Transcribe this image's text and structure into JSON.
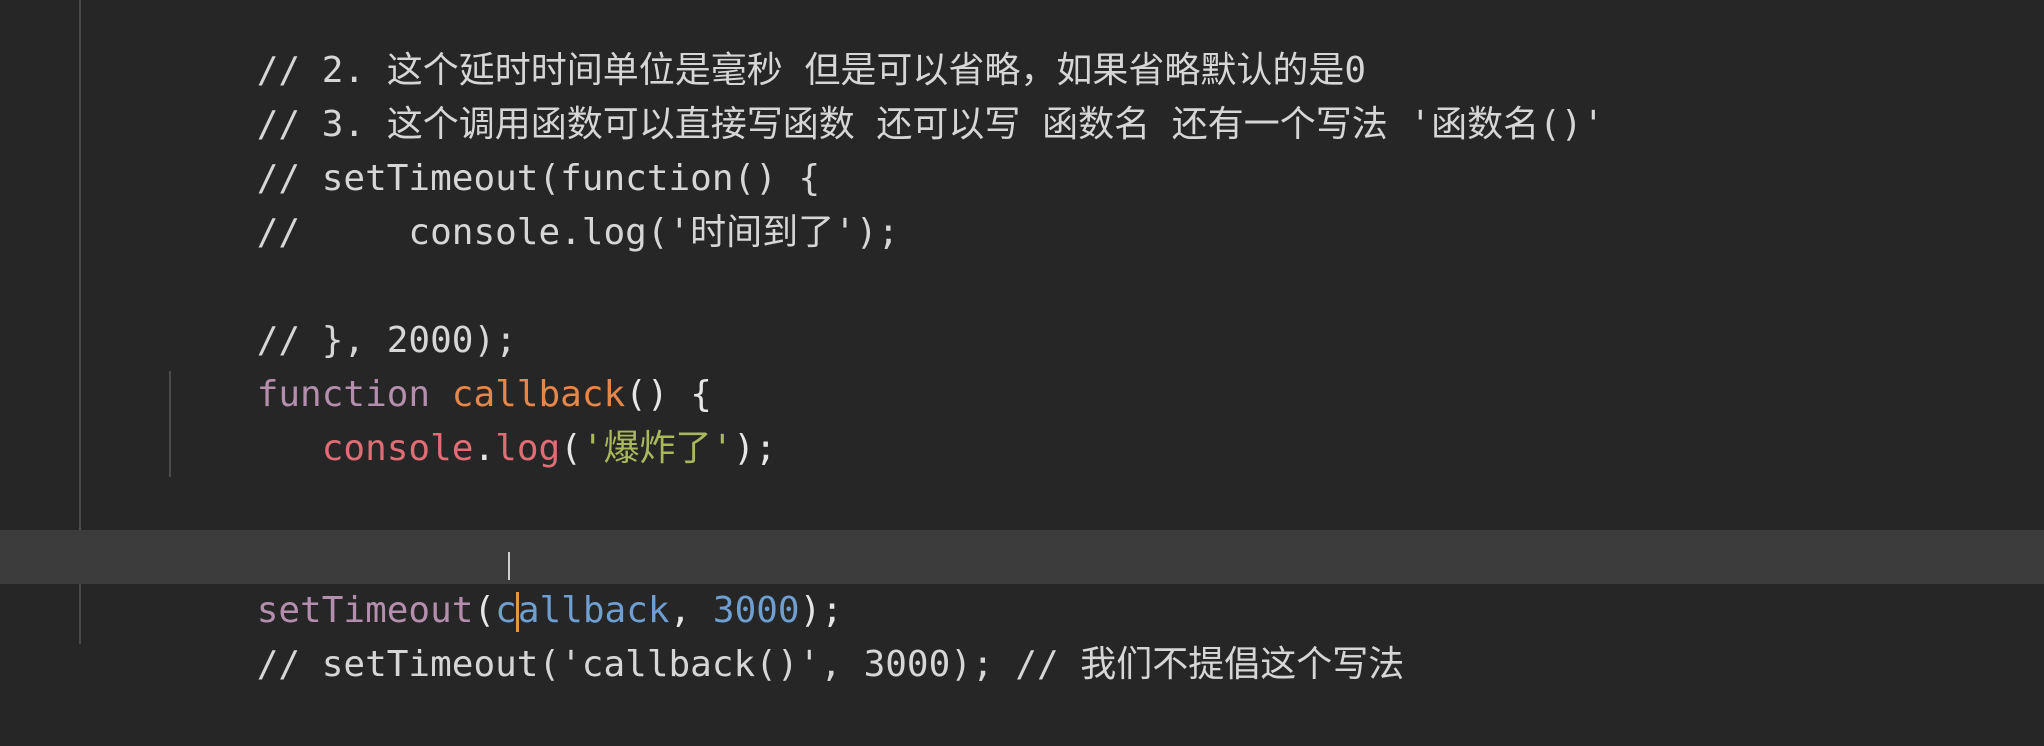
{
  "editor": {
    "lines": [
      {
        "comment": "// 2. 这个延时时间单位是毫秒 但是可以省略，如果省略默认的是0"
      },
      {
        "comment": "// 3. 这个调用函数可以直接写函数 还可以写 函数名 还有一个写法 '函数名()'"
      },
      {
        "comment": "// setTimeout(function() {"
      },
      {
        "comment": "//     console.log('时间到了');"
      },
      {
        "comment": ""
      },
      {
        "comment": "// }, 2000);"
      },
      {
        "keyword": "function",
        "name": "callback",
        "punct": "() {"
      },
      {
        "object": "console",
        "dot": ".",
        "method": "log",
        "open": "(",
        "string": "'爆炸了'",
        "close": ");"
      },
      {
        "comment": ""
      },
      {
        "punct": "}"
      },
      {
        "call": "setTimeout",
        "open": "(",
        "arg_a": "c",
        "arg_b": "allback",
        "comma": ", ",
        "number": "3000",
        "close": ");"
      },
      {
        "comment": "// setTimeout('callback()', 3000); // 我们不提倡这个写法"
      }
    ]
  },
  "colors": {
    "background": "#262626",
    "current_line": "#3c3c3c",
    "comment": "#d6d6d6",
    "keyword": "#b48ead",
    "function_name": "#e5864a",
    "object": "#e06c75",
    "string": "#a8b85a",
    "number": "#6f9fd1",
    "caret": "#e09a3e"
  }
}
